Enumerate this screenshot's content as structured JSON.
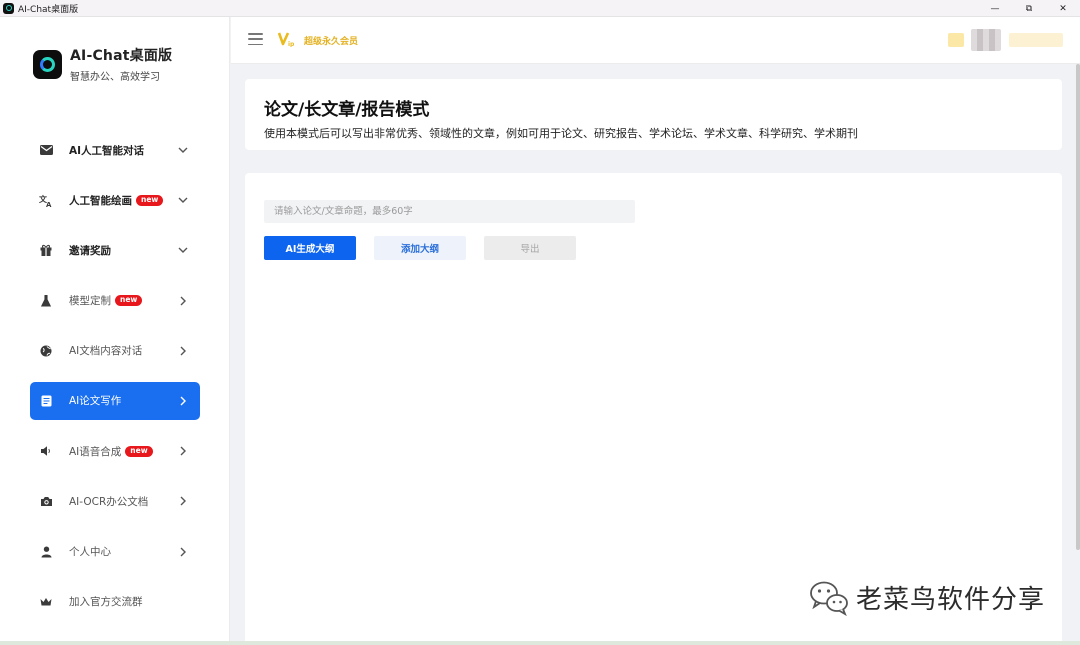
{
  "window": {
    "title": "AI-Chat桌面版",
    "minimize": "—",
    "maximize": "⧉",
    "close": "✕"
  },
  "brand": {
    "name": "AI-Chat桌面版",
    "tagline": "智慧办公、高效学习"
  },
  "menu": {
    "items": [
      {
        "label": "AI人工智能对话",
        "icon": "mail-icon",
        "arrow": "chevron-down",
        "badge": ""
      },
      {
        "label": "人工智能绘画",
        "icon": "translate-icon",
        "arrow": "chevron-down",
        "badge": "new"
      },
      {
        "label": "邀请奖励",
        "icon": "gift-icon",
        "arrow": "chevron-down",
        "badge": ""
      },
      {
        "label": "模型定制",
        "icon": "flask-icon",
        "arrow": "chevron-right",
        "badge": "new"
      },
      {
        "label": "AI文档内容对话",
        "icon": "globe-icon",
        "arrow": "chevron-right",
        "badge": ""
      },
      {
        "label": "AI论文写作",
        "icon": "document-icon",
        "arrow": "chevron-right",
        "badge": "",
        "active": true
      },
      {
        "label": "AI语音合成",
        "icon": "speaker-icon",
        "arrow": "chevron-right",
        "badge": "new"
      },
      {
        "label": "AI-OCR办公文档",
        "icon": "camera-icon",
        "arrow": "chevron-right",
        "badge": ""
      },
      {
        "label": "个人中心",
        "icon": "user-icon",
        "arrow": "chevron-right",
        "badge": ""
      },
      {
        "label": "加入官方交流群",
        "icon": "crown-icon",
        "arrow": "",
        "badge": ""
      }
    ]
  },
  "header": {
    "vip_label": "超级永久会员"
  },
  "hero": {
    "title": "论文/长文章/报告模式",
    "description": "使用本模式后可以写出非常优秀、领域性的文章，例如可用于论文、研究报告、学术论坛、学术文章、科学研究、学术期刊"
  },
  "form": {
    "topic_placeholder": "请输入论文/文章命题，最多60字",
    "topic_value": "",
    "generate_label": "AI生成大纲",
    "add_label": "添加大纲",
    "export_label": "导出"
  },
  "watermark": {
    "text": "老菜鸟软件分享"
  },
  "colors": {
    "accent": "#0d64ee",
    "active_menu": "#1a6ff0",
    "badge": "#e8171c",
    "vip": "#e4b223"
  }
}
